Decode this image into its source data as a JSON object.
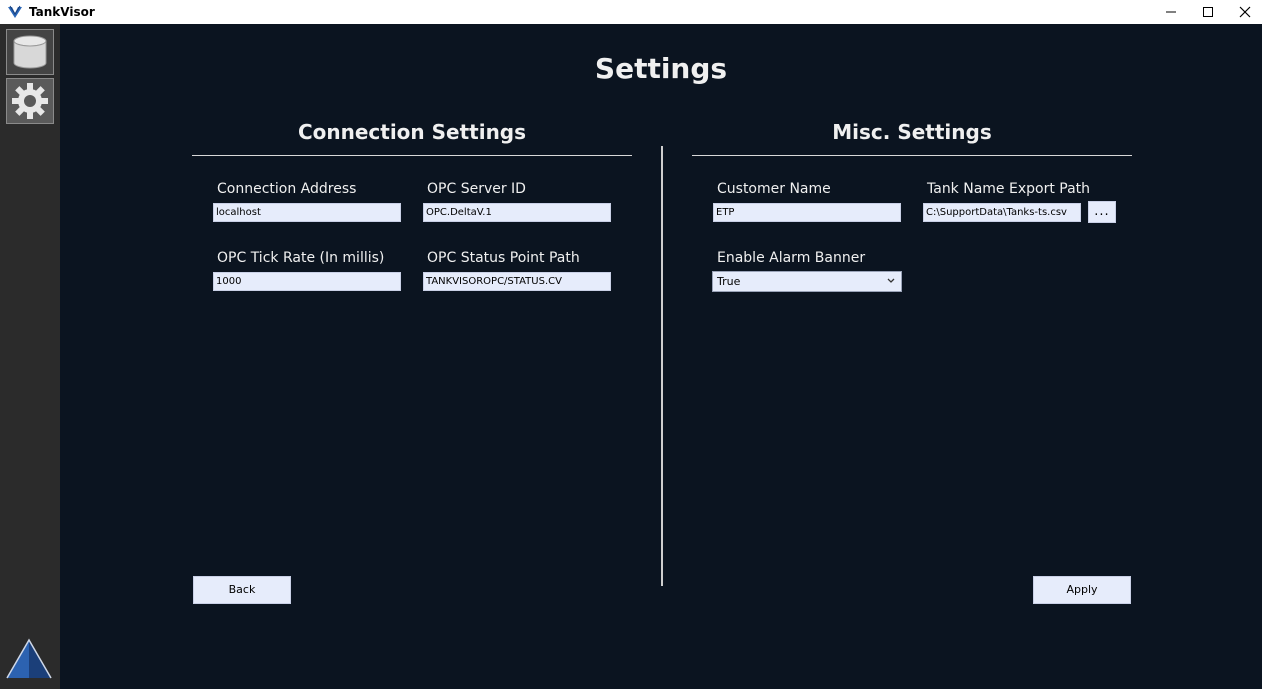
{
  "window": {
    "title": "TankVisor"
  },
  "page": {
    "title": "Settings"
  },
  "connection": {
    "title": "Connection Settings",
    "address": {
      "label": "Connection Address",
      "value": "localhost"
    },
    "server_id": {
      "label": "OPC Server ID",
      "value": "OPC.DeltaV.1"
    },
    "tick_rate": {
      "label": "OPC Tick Rate (In millis)",
      "value": "1000"
    },
    "status_path": {
      "label": "OPC Status Point Path",
      "value": "TANKVISOROPC/STATUS.CV"
    }
  },
  "misc": {
    "title": "Misc. Settings",
    "customer_name": {
      "label": "Customer Name",
      "value": "ETP"
    },
    "export_path": {
      "label": "Tank Name Export Path",
      "value": "C:\\SupportData\\Tanks-ts.csv",
      "browse_label": "..."
    },
    "alarm_banner": {
      "label": "Enable Alarm Banner",
      "value": "True"
    }
  },
  "buttons": {
    "back": "Back",
    "apply": "Apply"
  },
  "sidebar": {
    "items": [
      {
        "icon": "database-icon"
      },
      {
        "icon": "gear-icon"
      }
    ]
  },
  "colors": {
    "background": "#0b1420",
    "field": "#e6ecfb",
    "sidebar": "#2b2b2b"
  }
}
